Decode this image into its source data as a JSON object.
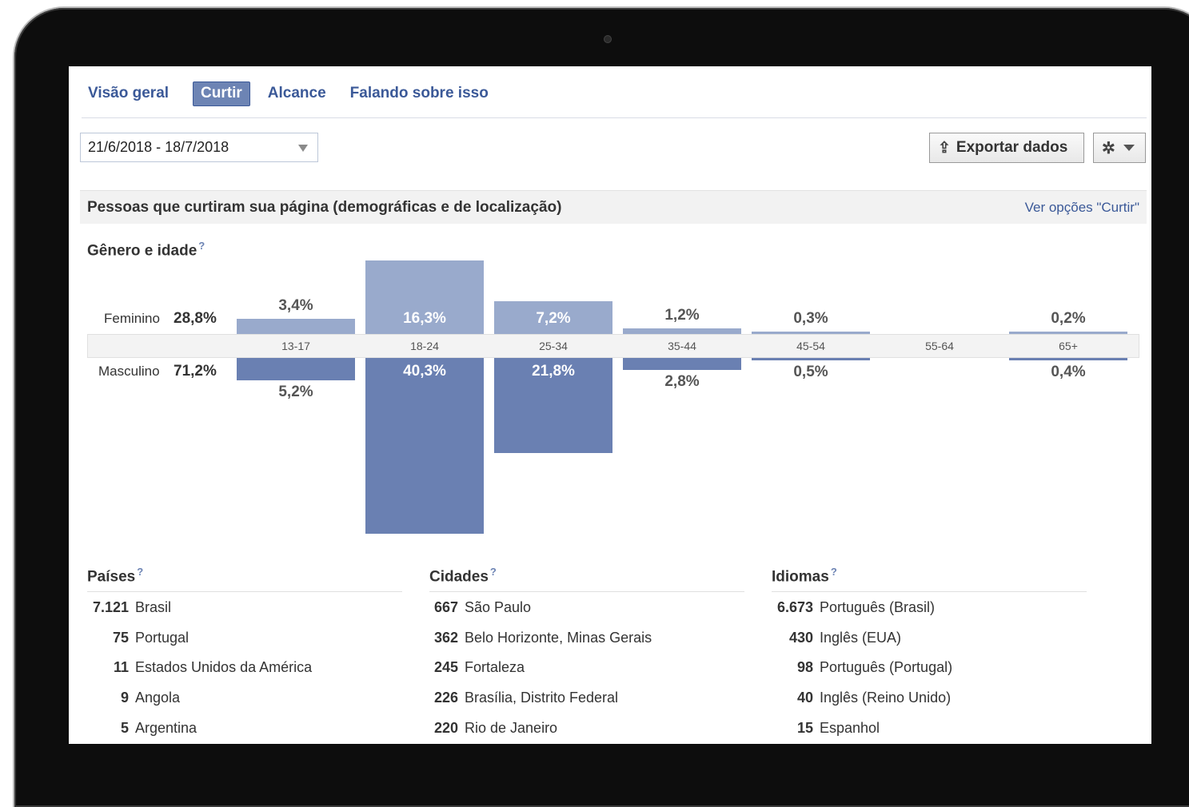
{
  "tabs": [
    {
      "label": "Visão geral",
      "active": false
    },
    {
      "label": "Curtir",
      "active": true
    },
    {
      "label": "Alcance",
      "active": false
    },
    {
      "label": "Falando sobre isso",
      "active": false
    }
  ],
  "date_range": {
    "value": "21/6/2018 - 18/7/2018"
  },
  "toolbar": {
    "export_label": "Exportar dados",
    "export_icon": "upload-icon",
    "settings_icon": "gear-icon"
  },
  "section": {
    "title": "Pessoas que curtiram sua página (demográficas e de localização)",
    "link": "Ver opções \"Curtir\""
  },
  "gender_age": {
    "heading": "Gênero e idade",
    "help": "?",
    "female_label": "Feminino",
    "female_total": "28,8%",
    "male_label": "Masculino",
    "male_total": "71,2%"
  },
  "chart_data": {
    "type": "bar",
    "categories": [
      "13-17",
      "18-24",
      "25-34",
      "35-44",
      "45-54",
      "55-64",
      "65+"
    ],
    "series": [
      {
        "name": "Feminino",
        "values": [
          3.4,
          16.3,
          7.2,
          1.2,
          0.3,
          0,
          0.2
        ],
        "labels": [
          "3,4%",
          "16,3%",
          "7,2%",
          "1,2%",
          "0,3%",
          "",
          "0,2%"
        ]
      },
      {
        "name": "Masculino",
        "values": [
          5.2,
          40.3,
          21.8,
          2.8,
          0.5,
          0,
          0.4
        ],
        "labels": [
          "5,2%",
          "40,3%",
          "21,8%",
          "2,8%",
          "0,5%",
          "",
          "0,4%"
        ]
      }
    ],
    "colors": {
      "female": "#99aacc",
      "male": "#6a80b2"
    }
  },
  "countries": {
    "heading": "Países",
    "help": "?",
    "rows": [
      {
        "num": "7.121",
        "name": "Brasil"
      },
      {
        "num": "75",
        "name": "Portugal"
      },
      {
        "num": "11",
        "name": "Estados Unidos da América"
      },
      {
        "num": "9",
        "name": "Angola"
      },
      {
        "num": "5",
        "name": "Argentina"
      }
    ]
  },
  "cities": {
    "heading": "Cidades",
    "help": "?",
    "rows": [
      {
        "num": "667",
        "name": "São Paulo"
      },
      {
        "num": "362",
        "name": "Belo Horizonte, Minas Gerais"
      },
      {
        "num": "245",
        "name": "Fortaleza"
      },
      {
        "num": "226",
        "name": "Brasília, Distrito Federal"
      },
      {
        "num": "220",
        "name": "Rio de Janeiro"
      }
    ]
  },
  "languages": {
    "heading": "Idiomas",
    "help": "?",
    "rows": [
      {
        "num": "6.673",
        "name": "Português (Brasil)"
      },
      {
        "num": "430",
        "name": "Inglês (EUA)"
      },
      {
        "num": "98",
        "name": "Português (Portugal)"
      },
      {
        "num": "40",
        "name": "Inglês (Reino Unido)"
      },
      {
        "num": "15",
        "name": "Espanhol"
      }
    ]
  }
}
